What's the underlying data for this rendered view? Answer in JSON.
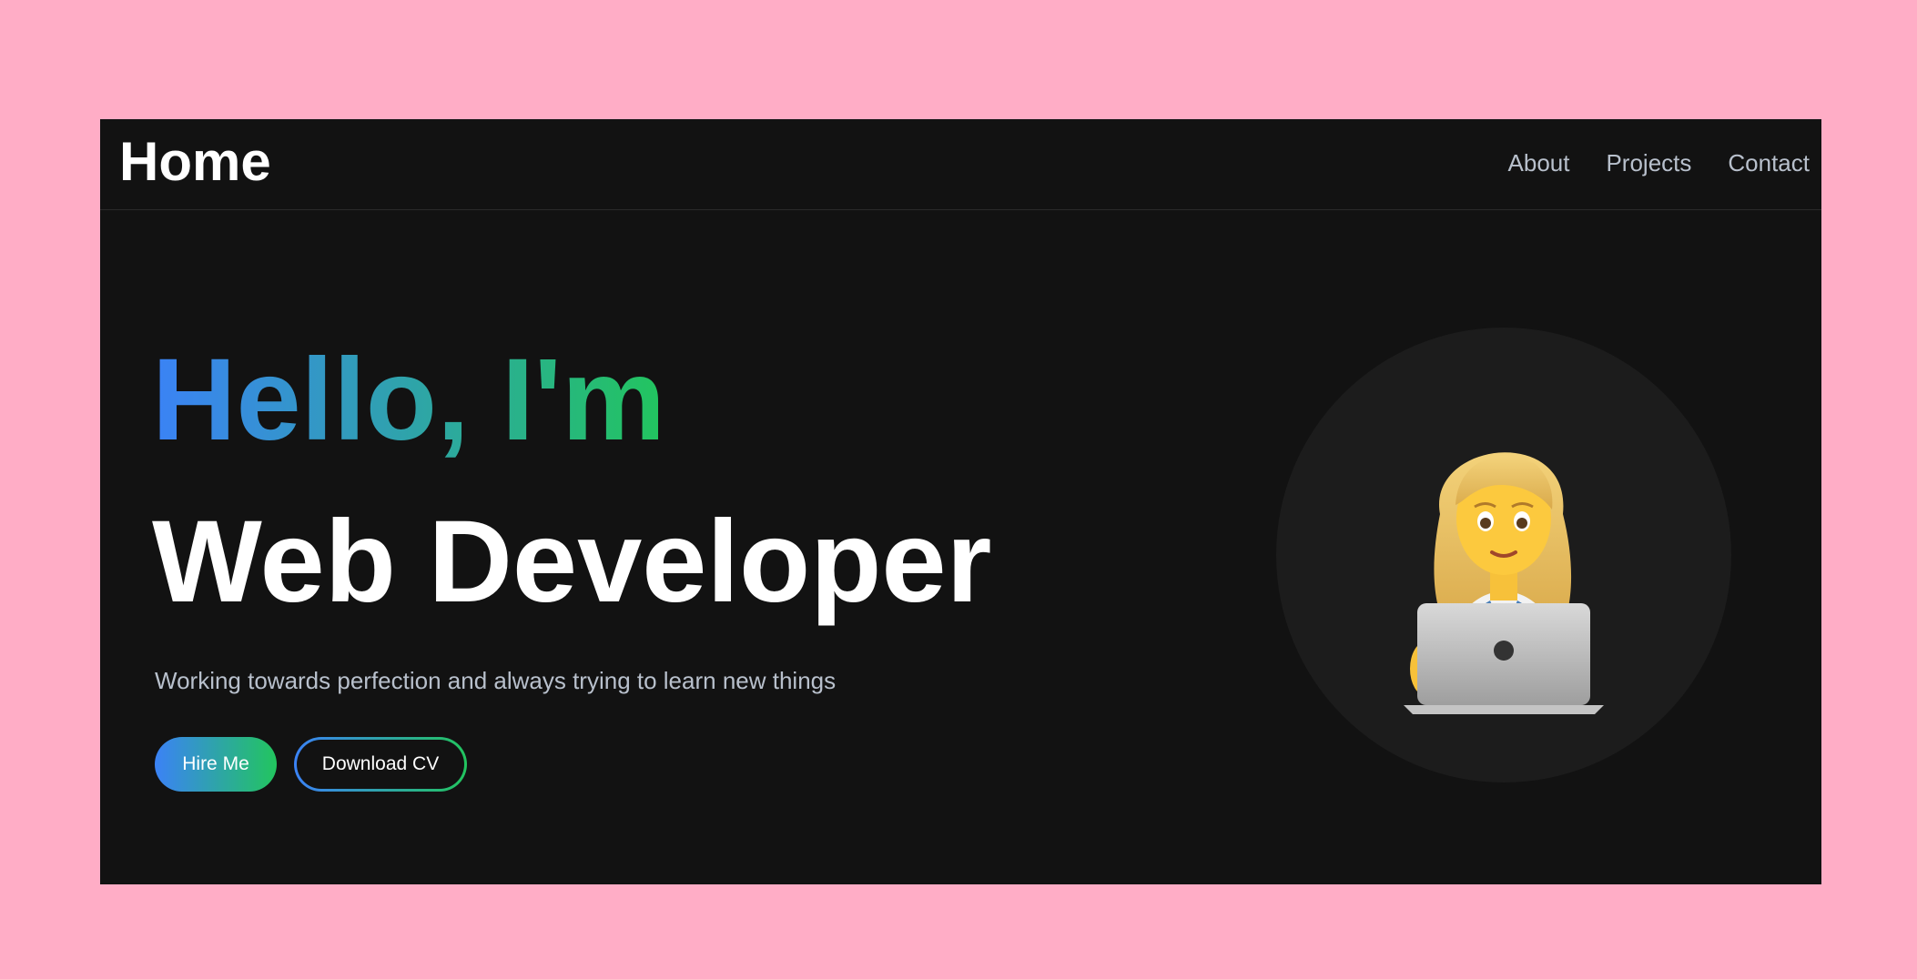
{
  "nav": {
    "brand": "Home",
    "links": [
      {
        "label": "About"
      },
      {
        "label": "Projects"
      },
      {
        "label": "Contact"
      }
    ]
  },
  "hero": {
    "greeting": "Hello, I'm",
    "role": "Web Developer",
    "subtitle": "Working towards perfection and always trying to learn new things",
    "primary_button": "Hire Me",
    "secondary_button": "Download CV",
    "avatar_icon": "woman-technologist-emoji"
  },
  "colors": {
    "page_background": "#ffadc6",
    "window_background": "#121212",
    "gradient_start": "#3b82f6",
    "gradient_end": "#22c55e",
    "muted_text": "#b8c0cc"
  }
}
